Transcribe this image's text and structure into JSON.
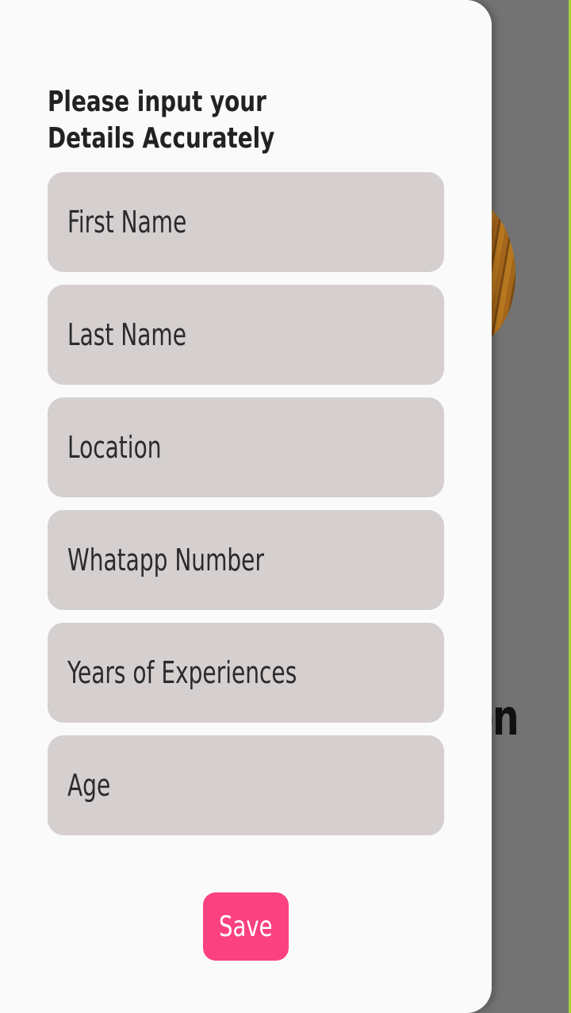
{
  "background": {
    "partial_title": "on"
  },
  "form": {
    "heading": "Please input your Details Accurately",
    "fields": [
      {
        "placeholder": "First Name",
        "value": ""
      },
      {
        "placeholder": "Last Name",
        "value": ""
      },
      {
        "placeholder": "Location",
        "value": ""
      },
      {
        "placeholder": "Whatapp Number",
        "value": ""
      },
      {
        "placeholder": "Years of Experiences",
        "value": ""
      },
      {
        "placeholder": "Age",
        "value": ""
      }
    ],
    "save_label": "Save"
  },
  "colors": {
    "accent": "#fb4180",
    "field_bg": "#d5cfcf",
    "drawer_bg": "#fafafa",
    "scrim": "#737373",
    "edge": "#a8d23a"
  }
}
